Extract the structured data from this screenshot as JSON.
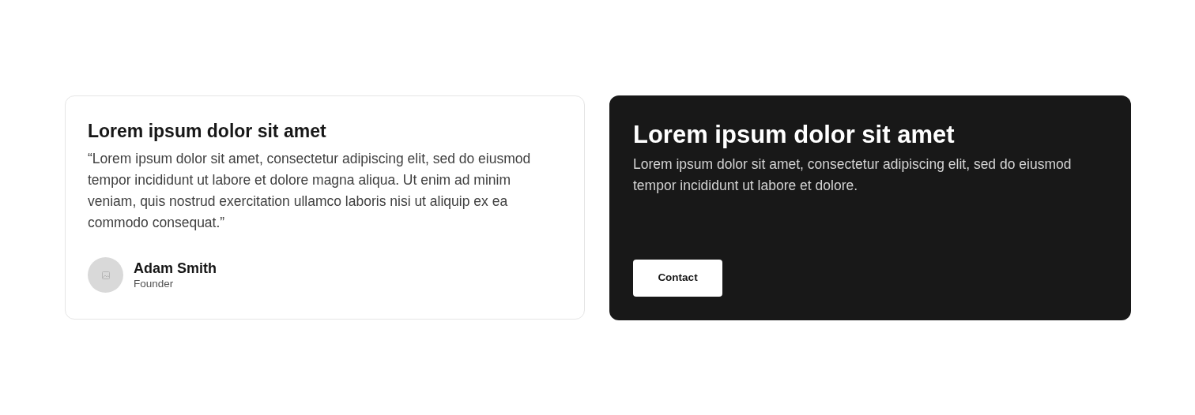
{
  "testimonial": {
    "title": "Lorem ipsum dolor sit amet",
    "quote": "“Lorem ipsum dolor sit amet, consectetur adipiscing elit, sed do eiusmod tempor incididunt ut labore et dolore magna aliqua. Ut enim ad minim veniam, quis nostrud exercitation ullamco laboris nisi ut aliquip ex ea commodo consequat.”",
    "author": {
      "name": "Adam Smith",
      "role": "Founder"
    }
  },
  "cta": {
    "title": "Lorem ipsum dolor sit amet",
    "text": "Lorem ipsum dolor sit amet, consectetur adipiscing elit, sed do eiusmod tempor incididunt ut labore et dolore.",
    "button": "Contact"
  }
}
